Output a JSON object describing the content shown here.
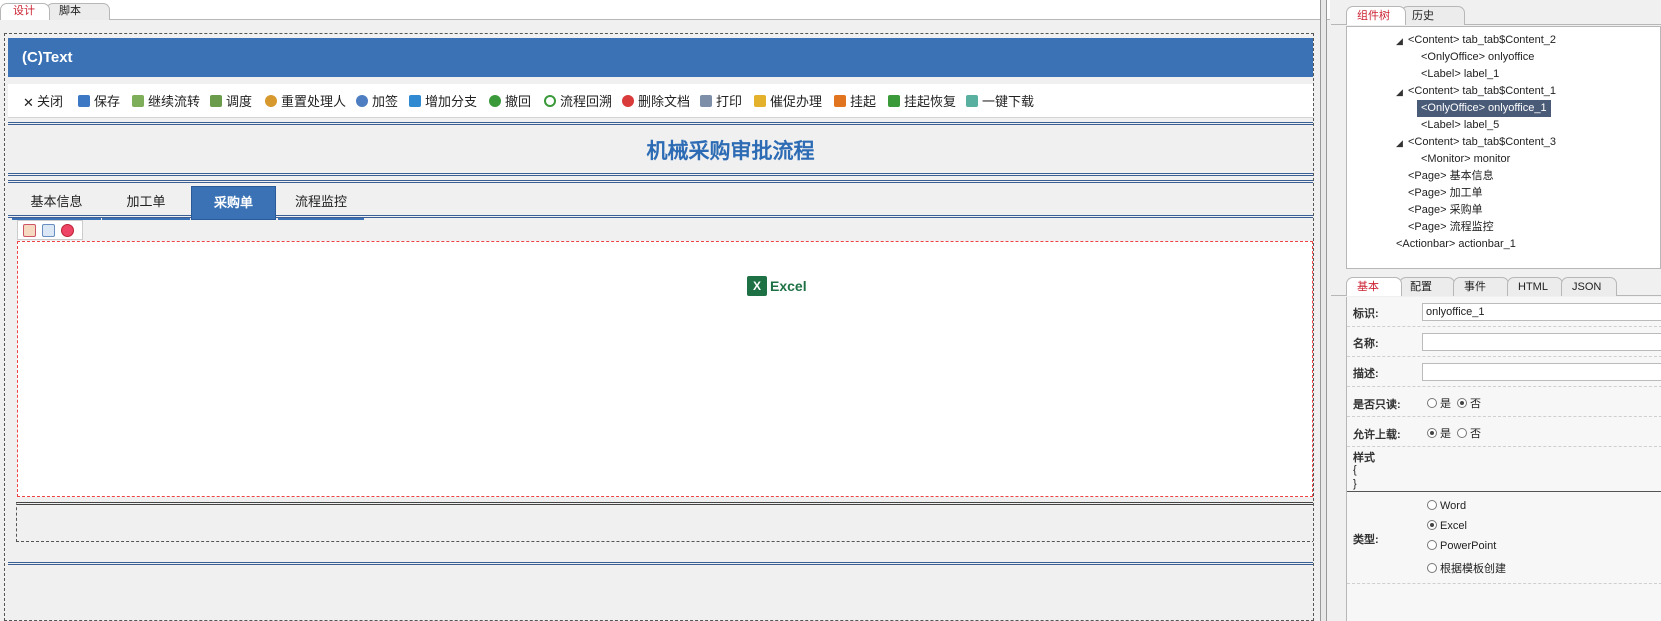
{
  "top_tabs": [
    "设计",
    "脚本"
  ],
  "form": {
    "title_bar": "(C)Text",
    "process_title": "机械采购审批流程",
    "page_tabs": [
      "基本信息",
      "加工单",
      "采购单",
      "流程监控"
    ],
    "active_page_tab": "采购单",
    "excel_label": "Excel"
  },
  "actionbar": {
    "items": [
      "关闭",
      "保存",
      "继续流转",
      "调度",
      "重置处理人",
      "加签",
      "增加分支",
      "撤回",
      "流程回溯",
      "删除文档",
      "打印",
      "催促办理",
      "挂起",
      "挂起恢复",
      "一键下载"
    ]
  },
  "right": {
    "tree_tabs": [
      "组件树",
      "历史"
    ],
    "tree": [
      {
        "text": "<Content> tab_tab$Content_2",
        "expanded": true
      },
      {
        "text": "<OnlyOffice> onlyoffice"
      },
      {
        "text": "<Label> label_1"
      },
      {
        "text": "<Content> tab_tab$Content_1",
        "expanded": true
      },
      {
        "text": "<OnlyOffice> onlyoffice_1",
        "selected": true
      },
      {
        "text": "<Label> label_5"
      },
      {
        "text": "<Content> tab_tab$Content_3",
        "expanded": true
      },
      {
        "text": "<Monitor> monitor"
      },
      {
        "text": "<Page> 基本信息"
      },
      {
        "text": "<Page> 加工单"
      },
      {
        "text": "<Page> 采购单"
      },
      {
        "text": "<Page> 流程监控"
      },
      {
        "text": "<Actionbar> actionbar_1"
      }
    ],
    "prop_tabs": [
      "基本",
      "配置",
      "事件",
      "HTML",
      "JSON"
    ],
    "props": {
      "id_label": "标识:",
      "id_value": "onlyoffice_1",
      "name_label": "名称:",
      "desc_label": "描述:",
      "readonly_label": "是否只读:",
      "readonly_options": [
        "是",
        "否"
      ],
      "readonly_selected": "否",
      "upload_label": "允许上载:",
      "upload_options": [
        "是",
        "否"
      ],
      "upload_selected": "是",
      "style_label": "样式",
      "style_open": "{",
      "style_close": "}",
      "type_label": "类型:",
      "type_options": [
        "Word",
        "Excel",
        "PowerPoint",
        "根据模板创建"
      ],
      "type_selected": "Excel"
    }
  },
  "colors": {
    "primary": "#3a72b5",
    "title_text": "#2d6cb5",
    "excel_green": "#1e7145",
    "tab_active_text": "#cc2233"
  }
}
